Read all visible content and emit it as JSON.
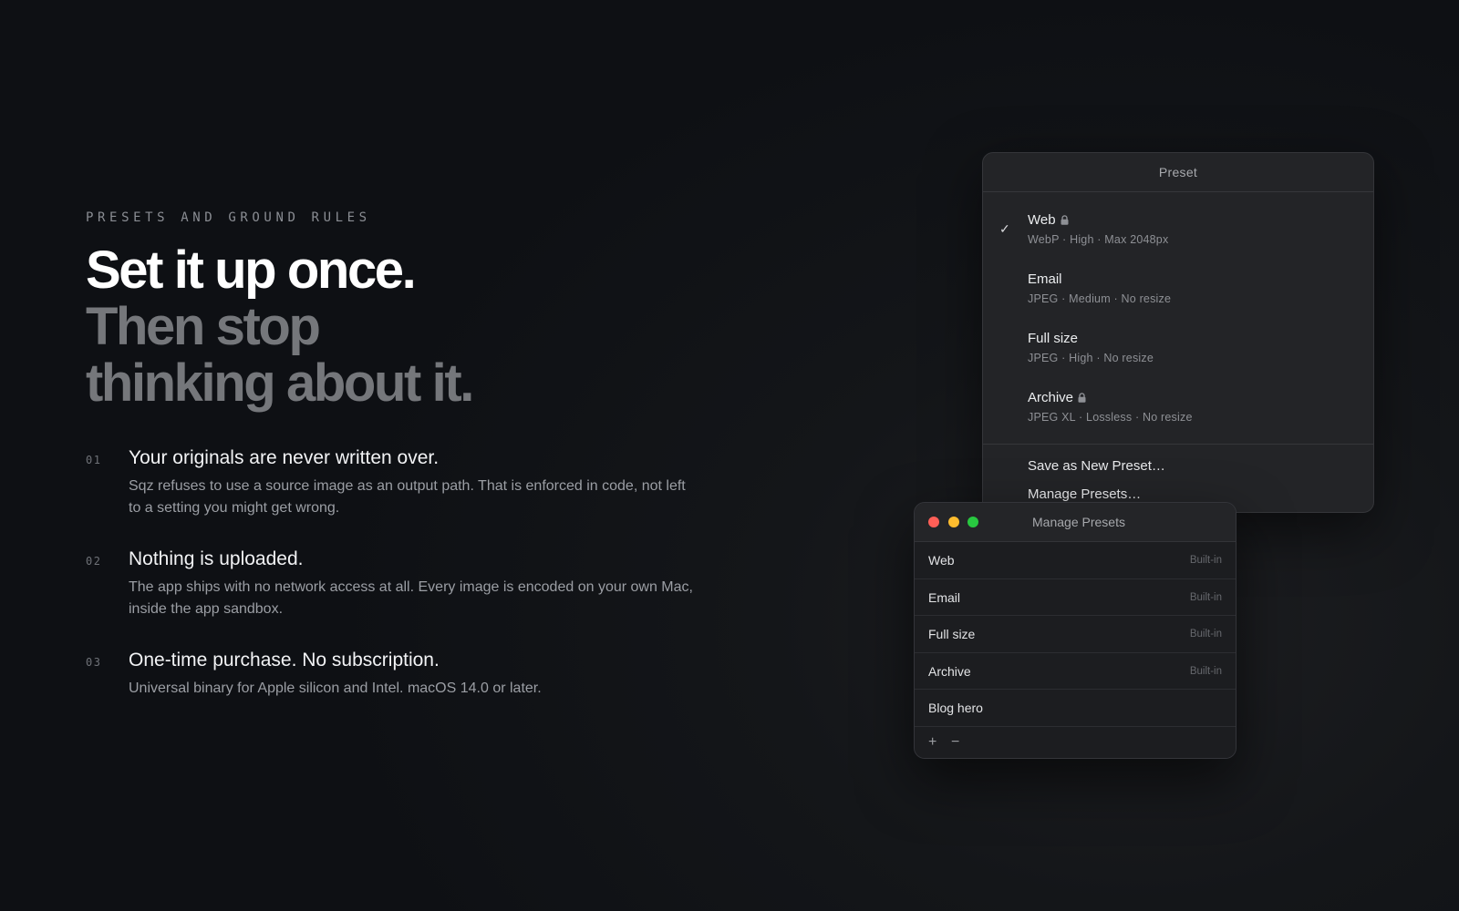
{
  "eyebrow": "PRESETS AND GROUND RULES",
  "headline": {
    "line1": "Set it up once.",
    "line2": "Then stop",
    "line3": "thinking about it."
  },
  "features": [
    {
      "num": "01",
      "title": "Your originals are never written over.",
      "body": "Sqz refuses to use a source image as an output path. That is enforced in code, not left to a setting you might get wrong."
    },
    {
      "num": "02",
      "title": "Nothing is uploaded.",
      "body": "The app ships with no network access at all. Every image is encoded on your own Mac, inside the app sandbox."
    },
    {
      "num": "03",
      "title": "One-time purchase. No subscription.",
      "body": "Universal binary for Apple silicon and Intel. macOS 14.0 or later."
    }
  ],
  "preset_menu": {
    "title": "Preset",
    "items": [
      {
        "name": "Web",
        "desc": "WebP · High · Max 2048px",
        "checked": true,
        "locked": true
      },
      {
        "name": "Email",
        "desc": "JPEG · Medium · No resize",
        "checked": false,
        "locked": false
      },
      {
        "name": "Full size",
        "desc": "JPEG · High · No resize",
        "checked": false,
        "locked": false
      },
      {
        "name": "Archive",
        "desc": "JPEG XL · Lossless · No resize",
        "checked": false,
        "locked": true
      }
    ],
    "check_glyph": "✓",
    "save_label": "Save as New Preset…",
    "manage_label": "Manage Presets…"
  },
  "manage_window": {
    "title": "Manage Presets",
    "rows": [
      {
        "name": "Web",
        "tag": "Built-in"
      },
      {
        "name": "Email",
        "tag": "Built-in"
      },
      {
        "name": "Full size",
        "tag": "Built-in"
      },
      {
        "name": "Archive",
        "tag": "Built-in"
      },
      {
        "name": "Blog hero",
        "tag": ""
      }
    ],
    "add_glyph": "+",
    "remove_glyph": "−"
  },
  "colors": {
    "background": "#0f1115",
    "headline_primary": "#ffffff",
    "headline_secondary": "#75777b",
    "close": "#ff5f57",
    "minimize": "#febc2e",
    "zoom": "#28c840"
  }
}
